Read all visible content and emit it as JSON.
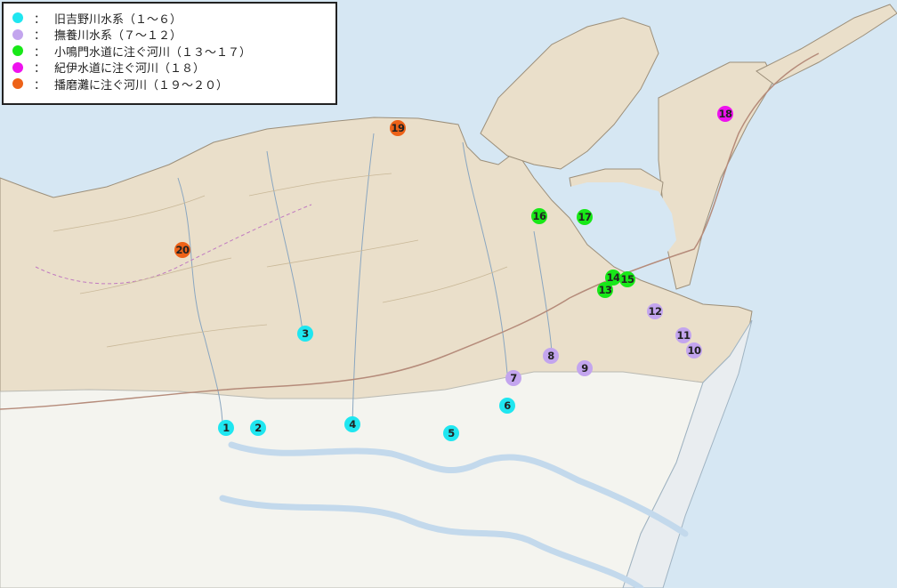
{
  "colors": {
    "sea": "#d6e7f3",
    "land_hill": "#eadfca",
    "land_plain": "#f4f4ef",
    "lowland": "#e9edf0",
    "river": "#c3d9ec",
    "cyan": "#1fe6f0",
    "lavender": "#c3a5ee",
    "green": "#18e818",
    "magenta": "#ee12ee",
    "orange": "#ed6218"
  },
  "legend": {
    "items": [
      {
        "color": "#1fe6f0",
        "sep": "：",
        "label": "旧吉野川水系（１～６）"
      },
      {
        "color": "#c3a5ee",
        "sep": "：",
        "label": "撫養川水系（７～１２）"
      },
      {
        "color": "#18e818",
        "sep": "：",
        "label": "小鳴門水道に注ぐ河川（１３～１７）"
      },
      {
        "color": "#ee12ee",
        "sep": "：",
        "label": "紀伊水道に注ぐ河川（１８）"
      },
      {
        "color": "#ed6218",
        "sep": "：",
        "label": "播磨灘に注ぐ河川（１９～２０）"
      }
    ]
  },
  "markers": [
    {
      "label": "1",
      "group": "cyan"
    },
    {
      "label": "2",
      "group": "cyan"
    },
    {
      "label": "3",
      "group": "cyan"
    },
    {
      "label": "4",
      "group": "cyan"
    },
    {
      "label": "5",
      "group": "cyan"
    },
    {
      "label": "6",
      "group": "cyan"
    },
    {
      "label": "7",
      "group": "lavender"
    },
    {
      "label": "8",
      "group": "lavender"
    },
    {
      "label": "9",
      "group": "lavender"
    },
    {
      "label": "10",
      "group": "lavender"
    },
    {
      "label": "11",
      "group": "lavender"
    },
    {
      "label": "12",
      "group": "lavender"
    },
    {
      "label": "13",
      "group": "green"
    },
    {
      "label": "14",
      "group": "green"
    },
    {
      "label": "15",
      "group": "green"
    },
    {
      "label": "16",
      "group": "green"
    },
    {
      "label": "17",
      "group": "green"
    },
    {
      "label": "18",
      "group": "magenta"
    },
    {
      "label": "19",
      "group": "orange"
    },
    {
      "label": "20",
      "group": "orange"
    }
  ]
}
